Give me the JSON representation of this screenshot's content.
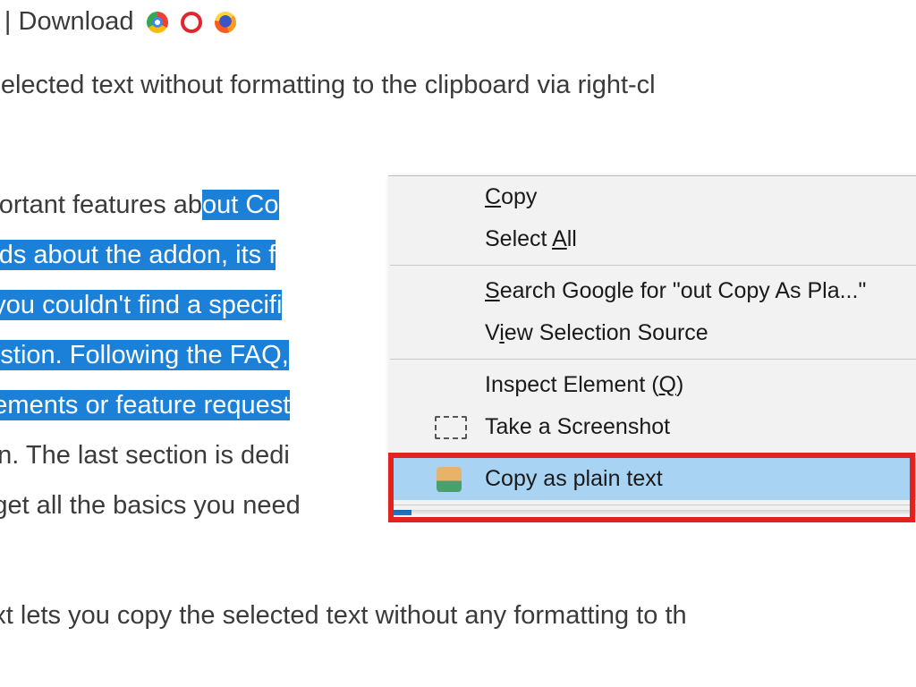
{
  "title": {
    "prefix": "n Text | ",
    "download": "Download"
  },
  "browser_icons": [
    "chrome",
    "opera",
    "firefox"
  ],
  "intro": "he selected text without formatting to the clipboard via right-cl",
  "paragraph": {
    "l1_pre": " important features ab",
    "l1_hl": "out Co",
    "l2_hl": " words about the addon, its f",
    "l3_hl": ". If you couldn't find a specifi",
    "l4_hl": "question.  Following  the  FAQ,",
    "l5_hl": "rovements or feature request",
    "l6": "lugin. The last section is dedi",
    "l7": "ou get all the basics you need"
  },
  "context_menu": {
    "copy": {
      "u": "C",
      "rest": "opy"
    },
    "select_all": {
      "pre": "Select ",
      "u": "A",
      "post": "ll"
    },
    "search": {
      "u": "S",
      "rest": "earch Google for \"out Copy As Pla...\""
    },
    "view_src": {
      "pre": "V",
      "u": "i",
      "post": "ew Selection Source"
    },
    "inspect": {
      "text": "Inspect Element (",
      "u": "Q",
      "post": ")"
    },
    "screenshot": "Take a Screenshot",
    "copy_plain": "Copy as plain text"
  },
  "trail": "n Text lets you copy the selected text without any formatting to th"
}
